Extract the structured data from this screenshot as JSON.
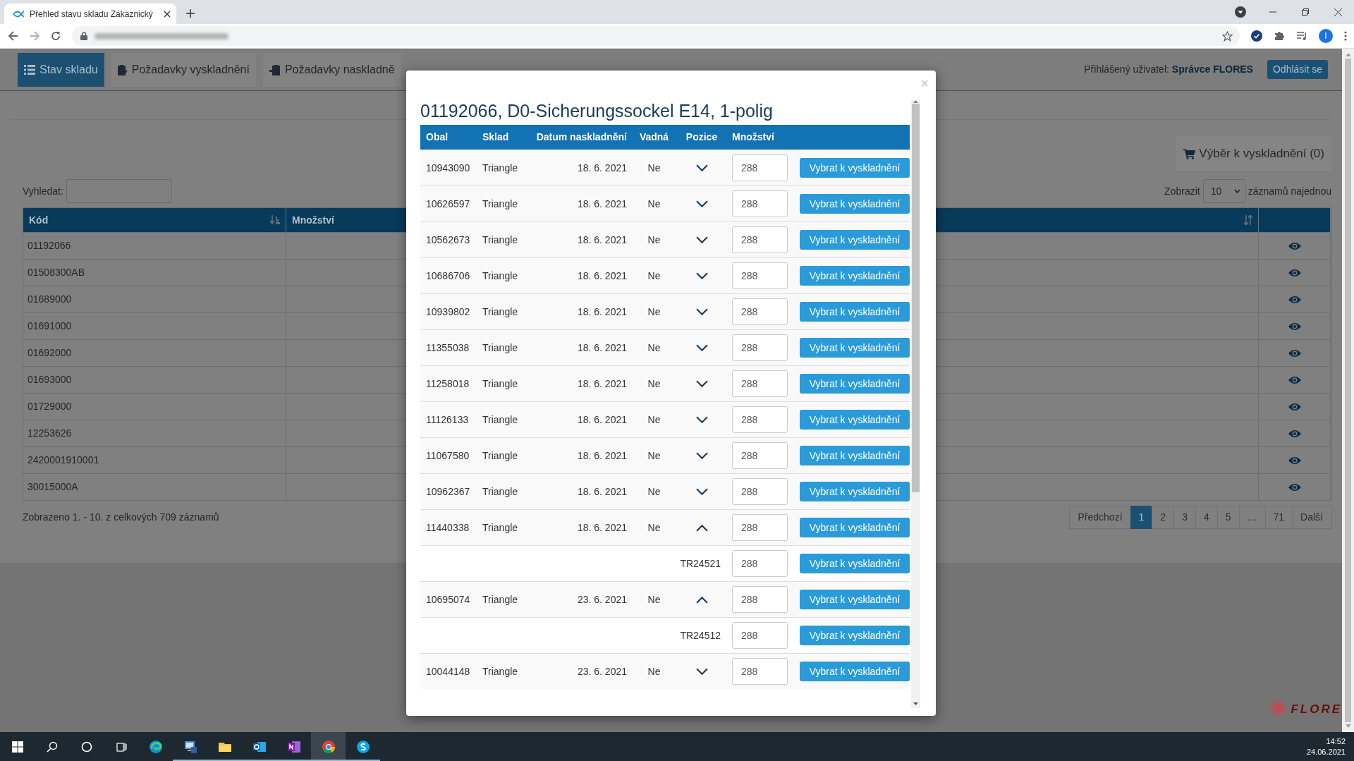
{
  "browser": {
    "tab_title": "Přehled stavu skladu Zákaznický",
    "profile_initial": "I"
  },
  "nav": {
    "items": [
      {
        "label": "Stav skladu",
        "selected": true
      },
      {
        "label": "Požadavky vyskladnění",
        "selected": false
      },
      {
        "label": "Požadavky naskladně",
        "selected": false
      }
    ],
    "user": "Přihlášený uživatel: **Správce FLORES**",
    "logout": "Odhlásit se"
  },
  "page": {
    "selection_button": "Výběr k vyskladnění (0)",
    "search_label": "Vyhledat:",
    "show_label": "Zobrazit",
    "page_size": "10",
    "show_suffix": "záznamů najednou",
    "columns": [
      "Kód",
      "Množství"
    ],
    "rows": [
      "01192066",
      "01508300AB",
      "01689000",
      "01691000",
      "01692000",
      "01693000",
      "01729000",
      "12253626",
      "2420001910001",
      "30015000A"
    ],
    "info": "Zobrazeno 1. - 10. z celkových 709 záznamů",
    "pagination": {
      "previous": "Předchozí",
      "next": "Další",
      "pages": [
        {
          "label": "1",
          "selected": true
        },
        {
          "label": "2",
          "selected": false
        },
        {
          "label": "3",
          "selected": false
        },
        {
          "label": "4",
          "selected": false
        },
        {
          "label": "5",
          "selected": false
        },
        {
          "label": "…",
          "selected": false
        },
        {
          "label": "71",
          "selected": false
        }
      ]
    }
  },
  "modal": {
    "close": "×",
    "title": "01192066, D0-Sicherungssockel E14, 1-polig",
    "columns": [
      "Obal",
      "Sklad",
      "Datum naskladnění",
      "Vadná",
      "Pozice",
      "Množství"
    ],
    "rows": [
      {
        "kind": "item",
        "obal": "10943090",
        "sklad": "Triangle",
        "date": "18. 6. 2021",
        "vadna": "Ne",
        "expanded": false,
        "quantity": "288",
        "button": "Vybrat k vyskladnění"
      },
      {
        "kind": "item",
        "obal": "10626597",
        "sklad": "Triangle",
        "date": "18. 6. 2021",
        "vadna": "Ne",
        "expanded": false,
        "quantity": "288",
        "button": "Vybrat k vyskladnění"
      },
      {
        "kind": "item",
        "obal": "10562673",
        "sklad": "Triangle",
        "date": "18. 6. 2021",
        "vadna": "Ne",
        "expanded": false,
        "quantity": "288",
        "button": "Vybrat k vyskladnění"
      },
      {
        "kind": "item",
        "obal": "10686706",
        "sklad": "Triangle",
        "date": "18. 6. 2021",
        "vadna": "Ne",
        "expanded": false,
        "quantity": "288",
        "button": "Vybrat k vyskladnění"
      },
      {
        "kind": "item",
        "obal": "10939802",
        "sklad": "Triangle",
        "date": "18. 6. 2021",
        "vadna": "Ne",
        "expanded": false,
        "quantity": "288",
        "button": "Vybrat k vyskladnění"
      },
      {
        "kind": "item",
        "obal": "11355038",
        "sklad": "Triangle",
        "date": "18. 6. 2021",
        "vadna": "Ne",
        "expanded": false,
        "quantity": "288",
        "button": "Vybrat k vyskladnění"
      },
      {
        "kind": "item",
        "obal": "11258018",
        "sklad": "Triangle",
        "date": "18. 6. 2021",
        "vadna": "Ne",
        "expanded": false,
        "quantity": "288",
        "button": "Vybrat k vyskladnění"
      },
      {
        "kind": "item",
        "obal": "11126133",
        "sklad": "Triangle",
        "date": "18. 6. 2021",
        "vadna": "Ne",
        "expanded": false,
        "quantity": "288",
        "button": "Vybrat k vyskladnění"
      },
      {
        "kind": "item",
        "obal": "11067580",
        "sklad": "Triangle",
        "date": "18. 6. 2021",
        "vadna": "Ne",
        "expanded": false,
        "quantity": "288",
        "button": "Vybrat k vyskladnění"
      },
      {
        "kind": "item",
        "obal": "10962367",
        "sklad": "Triangle",
        "date": "18. 6. 2021",
        "vadna": "Ne",
        "expanded": false,
        "quantity": "288",
        "button": "Vybrat k vyskladnění"
      },
      {
        "kind": "item",
        "obal": "11440338",
        "sklad": "Triangle",
        "date": "18. 6. 2021",
        "vadna": "Ne",
        "expanded": true,
        "quantity": "288",
        "button": "Vybrat k vyskladnění"
      },
      {
        "kind": "position",
        "position": "TR24521",
        "quantity": "288",
        "button": "Vybrat k vyskladnění"
      },
      {
        "kind": "item",
        "obal": "10695074",
        "sklad": "Triangle",
        "date": "23. 6. 2021",
        "vadna": "Ne",
        "expanded": true,
        "quantity": "288",
        "button": "Vybrat k vyskladnění"
      },
      {
        "kind": "position",
        "position": "TR24512",
        "quantity": "288",
        "button": "Vybrat k vyskladnění"
      },
      {
        "kind": "item",
        "obal": "10044148",
        "sklad": "Triangle",
        "date": "23. 6. 2021",
        "vadna": "Ne",
        "expanded": false,
        "quantity": "288",
        "button": "Vybrat k vyskladnění"
      }
    ]
  },
  "logo": "FLORE",
  "taskbar": {
    "apps": [
      {
        "running": false,
        "selected": false
      },
      {
        "running": true,
        "selected": false
      },
      {
        "running": true,
        "selected": false
      },
      {
        "running": true,
        "selected": false
      },
      {
        "running": true,
        "selected": false
      },
      {
        "running": true,
        "selected": true
      },
      {
        "running": true,
        "selected": false
      }
    ],
    "time": "14:52",
    "date": "24.06.2021"
  }
}
